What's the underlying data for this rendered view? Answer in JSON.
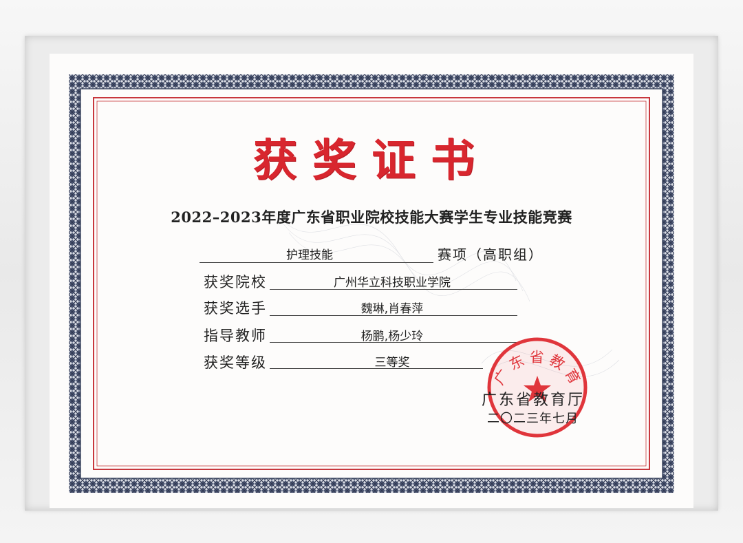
{
  "certificate": {
    "title": "获奖证书",
    "subtitle": "2022–2023年度广东省职业院校技能大赛学生专业技能竞赛",
    "event_value": "护理技能",
    "event_suffix": "赛项（高职组）",
    "fields": [
      {
        "label": "获奖院校",
        "value": "广州华立科技职业学院"
      },
      {
        "label": "获奖选手",
        "value": "魏琳,肖春萍"
      },
      {
        "label": "指导教师",
        "value": "杨鹏,杨少玲"
      },
      {
        "label": "获奖等级",
        "value": "三等奖"
      }
    ],
    "issuer": "广东省教育厅",
    "date": "二〇二三年七月",
    "seal_text": "广东省教育厅"
  },
  "colors": {
    "title_red": "#d8262e",
    "seal_red": "#e0353b",
    "border_blue": "#3c4660",
    "inner_red_line": "#c8373d"
  }
}
